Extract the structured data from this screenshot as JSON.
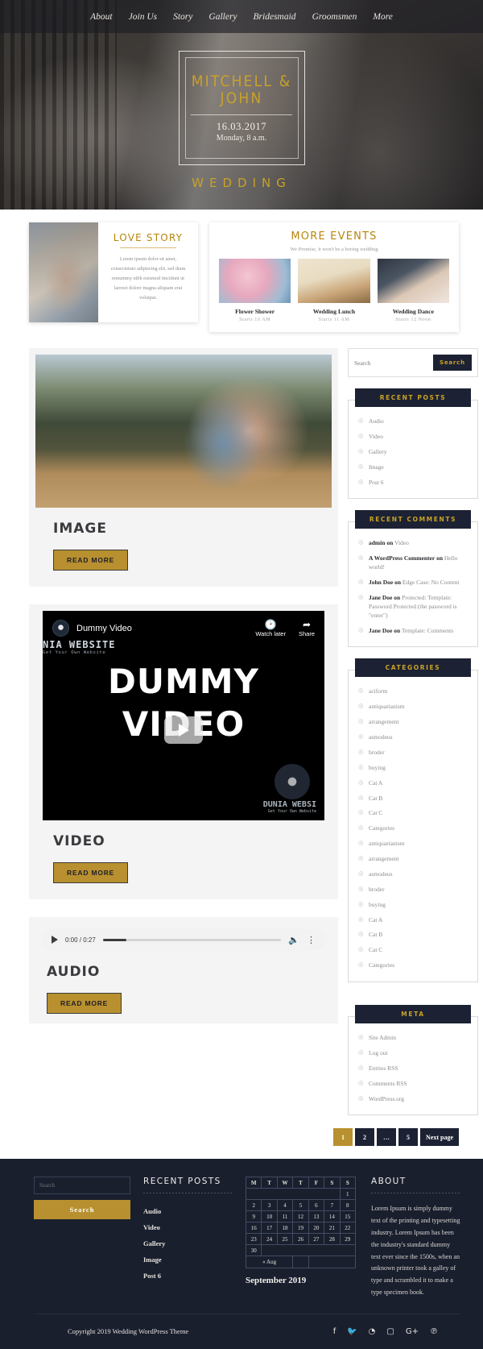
{
  "nav": {
    "items": [
      {
        "label": "About"
      },
      {
        "label": "Join Us"
      },
      {
        "label": "Story"
      },
      {
        "label": "Gallery"
      },
      {
        "label": "Bridesmaid"
      },
      {
        "label": "Groomsmen"
      },
      {
        "label": "More"
      }
    ]
  },
  "hero": {
    "names": "Mitchell\n& John",
    "date": "16.03.2017",
    "time": "Monday, 8 a.m.",
    "word": "Wedding"
  },
  "love_story": {
    "title": "Love Story",
    "text": "Lorem ipsum dolor sit amet, consectetuer adipiscing elit, sed diam nonummy nibh euismod tincidunt ut laoreet dolore magna aliquam erat volutpat."
  },
  "more_events": {
    "title": "More Events",
    "subtitle": "We Promise, it won't be a boring wedding",
    "events": [
      {
        "name": "Flower Shower",
        "time": "Starts 10 AM"
      },
      {
        "name": "Wedding Lunch",
        "time": "Starts 11 AM"
      },
      {
        "name": "Wedding Dance",
        "time": "Starts 12 Noon"
      }
    ]
  },
  "posts": [
    {
      "title": "Image",
      "read_more": "Read More"
    },
    {
      "title": "Video",
      "read_more": "Read More"
    },
    {
      "title": "Audio",
      "read_more": "Read More"
    }
  ],
  "video": {
    "channel": "Dummy Video",
    "watch_later": "Watch later",
    "share": "Share",
    "brand": "NIA WEBSITE",
    "brand_sub": "Get Your Own Website",
    "line1": "DUMMY",
    "line2": "VIDEO",
    "footer_brand": "DUNIA WEBSI",
    "footer_sub": "Get Your Own Website"
  },
  "audio": {
    "current_time": "0:00",
    "duration": "0:27",
    "time_label": "0:00 / 0:27"
  },
  "sidebar": {
    "search": {
      "placeholder": "Search",
      "button": "Search"
    },
    "recent_posts": {
      "title": "Recent Posts",
      "items": [
        "Audio",
        "Video",
        "Gallery",
        "Image",
        "Post 6"
      ]
    },
    "recent_comments": {
      "title": "Recent Comments",
      "items": [
        {
          "author": "admin",
          "on": "on",
          "target": "Video"
        },
        {
          "author": "A WordPress Commenter",
          "on": "on",
          "target": "Hello world!"
        },
        {
          "author": "John Doe",
          "on": "on",
          "target": "Edge Case: No Content"
        },
        {
          "author": "Jane Doe",
          "on": "on",
          "target": "Protected: Template: Password Protected (the password is \"enter\")"
        },
        {
          "author": "Jane Doe",
          "on": "on",
          "target": "Template: Comments"
        }
      ]
    },
    "categories": {
      "title": "Categories",
      "items": [
        "aciform",
        "antiquarianism",
        "arrangement",
        "asmodeus",
        "broder",
        "buying",
        "Cat A",
        "Cat B",
        "Cat C",
        "Categories",
        "antiquarianism",
        "arrangement",
        "asmodeus",
        "broder",
        "buying",
        "Cat A",
        "Cat B",
        "Cat C",
        "Categories"
      ]
    },
    "meta": {
      "title": "Meta",
      "items": [
        "Site Admin",
        "Log out",
        "Entries RSS",
        "Comments RSS",
        "WordPress.org"
      ]
    }
  },
  "pagination": {
    "pages": [
      "1",
      "2",
      "…",
      "5"
    ],
    "next": "Next page",
    "active_index": 0
  },
  "footer": {
    "search": {
      "placeholder": "Search",
      "button": "Search"
    },
    "recent_posts": {
      "title": "Recent Posts",
      "items": [
        "Audio",
        "Video",
        "Gallery",
        "Image",
        "Post 6"
      ]
    },
    "calendar": {
      "weekdays": [
        "M",
        "T",
        "W",
        "T",
        "F",
        "S",
        "S"
      ],
      "weeks": [
        [
          "",
          "",
          "",
          "",
          "",
          "",
          "1"
        ],
        [
          "2",
          "3",
          "4",
          "5",
          "6",
          "7",
          "8"
        ],
        [
          "9",
          "10",
          "11",
          "12",
          "13",
          "14",
          "15"
        ],
        [
          "16",
          "17",
          "18",
          "19",
          "20",
          "21",
          "22"
        ],
        [
          "23",
          "24",
          "25",
          "26",
          "27",
          "28",
          "29"
        ],
        [
          "30",
          "",
          "",
          "",
          "",
          "",
          ""
        ]
      ],
      "prev": "« Aug",
      "caption": "September 2019"
    },
    "about": {
      "title": "About",
      "text": "Lorem Ipsum is simply dummy text of the printing and typesetting industry. Lorem Ipsum has been the industry's standard dummy text ever since the 1500s, when an unknown printer took a galley of type and scrambled it to make a type specimen book."
    },
    "copyright": "Copyright 2019 Wedding WordPress Theme",
    "socials": [
      "facebook-icon",
      "twitter-icon",
      "rss-icon",
      "instagram-icon",
      "google-plus-icon",
      "pinterest-icon"
    ],
    "social_glyphs": [
      "f",
      "🐦",
      "◔",
      "▢",
      "G+",
      "℗"
    ]
  },
  "colors": {
    "gold": "#b8902f",
    "navy": "#1c2233",
    "footer_bg": "#1a1f2e",
    "hero_gold": "#c9a227"
  }
}
